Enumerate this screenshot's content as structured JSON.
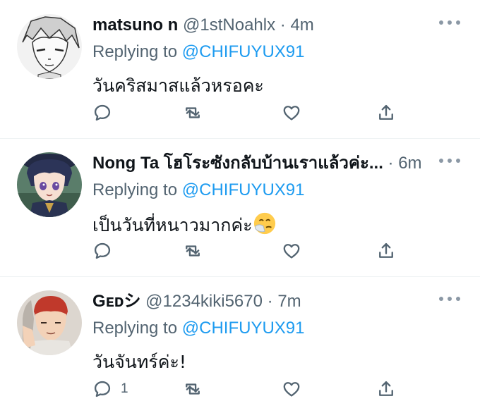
{
  "tweets": [
    {
      "display_name": "matsuno n",
      "handle": "@1stNoahlx",
      "dot": "·",
      "time": "4m",
      "replying_prefix": "Replying to",
      "replying_to": "@CHIFUYUX91",
      "text": "วันคริสมาสแล้วหรอคะ",
      "reply_count": "",
      "avatar_icon": "avatar-manga-boy-icon"
    },
    {
      "display_name": "Nong Ta โฮโระซังกลับบ้านเราแล้วค่ะ...",
      "handle": "",
      "dot": "·",
      "time": "6m",
      "replying_prefix": "Replying to",
      "replying_to": "@CHIFUYUX91",
      "text": "เป็นวันที่หนาวมากค่ะ",
      "emoji": "sneezing-face-emoji",
      "reply_count": "",
      "avatar_icon": "avatar-anime-boy-icon"
    },
    {
      "display_name": "Gᴇᴅシ",
      "handle": "@1234kiki5670",
      "dot": "·",
      "time": "7m",
      "replying_prefix": "Replying to",
      "replying_to": "@CHIFUYUX91",
      "text": "วันจันทร์ค่ะ!",
      "reply_count": "1",
      "avatar_icon": "avatar-red-hair-boy-icon"
    }
  ],
  "colors": {
    "accent": "#1d9bf0",
    "secondary_text": "#536471",
    "divider": "#eff3f4"
  }
}
